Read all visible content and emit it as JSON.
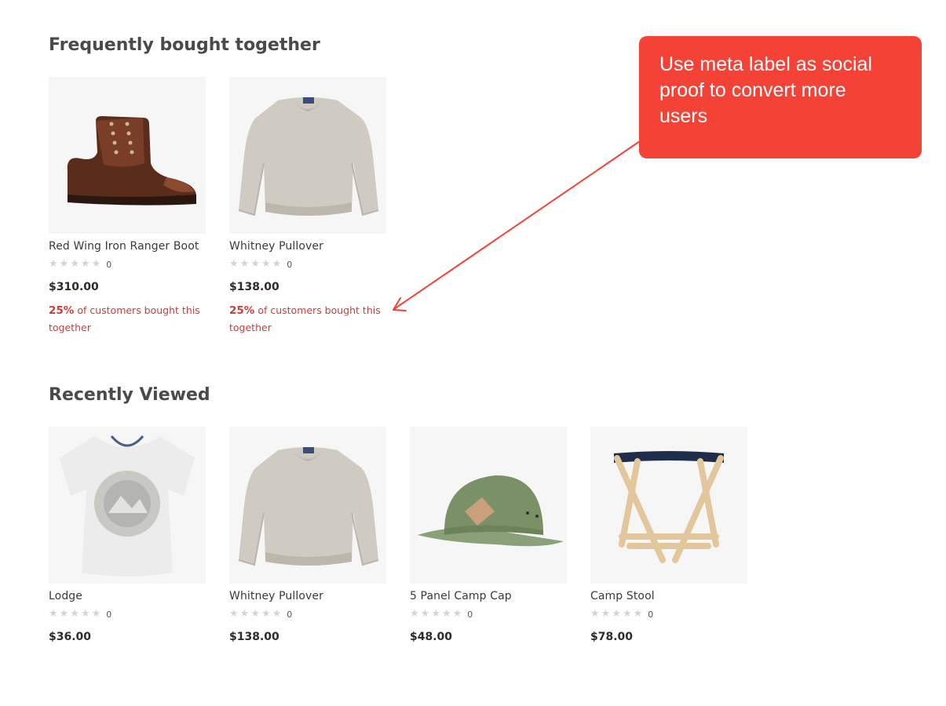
{
  "frequently_bought": {
    "title": "Frequently bought together",
    "products": [
      {
        "image": "boot",
        "name": "Red Wing Iron Ranger Boot",
        "rating_count": "0",
        "price": "$310.00",
        "meta_percent": "25%",
        "meta_text": "of customers bought this together"
      },
      {
        "image": "sweater",
        "name": "Whitney Pullover",
        "rating_count": "0",
        "price": "$138.00",
        "meta_percent": "25%",
        "meta_text": "of customers bought this together"
      }
    ]
  },
  "recently_viewed": {
    "title": "Recently Viewed",
    "products": [
      {
        "image": "tshirt",
        "name": "Lodge",
        "rating_count": "0",
        "price": "$36.00"
      },
      {
        "image": "sweater",
        "name": "Whitney Pullover",
        "rating_count": "0",
        "price": "$138.00"
      },
      {
        "image": "cap",
        "name": "5 Panel Camp Cap",
        "rating_count": "0",
        "price": "$48.00"
      },
      {
        "image": "stool",
        "name": "Camp Stool",
        "rating_count": "0",
        "price": "$78.00"
      }
    ]
  },
  "callout": {
    "text": "Use meta label as social proof to convert more users",
    "color": "#f44336"
  },
  "colors": {
    "meta_label": "#d23b35",
    "star_empty": "#d4d4d4",
    "image_bg": "#f6f6f6"
  }
}
